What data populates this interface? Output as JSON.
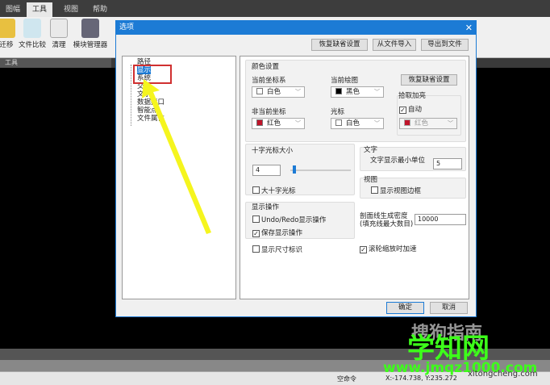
{
  "menubar": {
    "items": [
      "图幅",
      "工具",
      "视图",
      "帮助"
    ],
    "active": "工具"
  },
  "ribbon": {
    "buttons": [
      "迁移",
      "文件比较",
      "清理",
      "模块管理器"
    ],
    "group_label": "工具"
  },
  "dialog": {
    "title": "选项",
    "top_buttons": [
      "恢复缺省设置",
      "从文件导入",
      "导出到文件"
    ],
    "tree": [
      "路径",
      "显示",
      "系统",
      "交互",
      "文字",
      "数据接口",
      "智能点",
      "文件属性"
    ],
    "selected": "显示",
    "color_settings": {
      "title": "颜色设置",
      "current_coord_label": "当前坐标系",
      "current_coord_value": "白色",
      "current_draw_label": "当前绘图",
      "current_draw_value": "黑色",
      "noncurrent_coord_label": "非当前坐标",
      "noncurrent_coord_value": "红色",
      "cursor_label": "光标",
      "cursor_value": "白色",
      "restore_button": "恢复缺省设置",
      "pick_title": "拾取加亮",
      "auto_label": "自动",
      "auto_checked": true,
      "pick_value": "红色"
    },
    "crosshair": {
      "title": "十字光标大小",
      "value": "4",
      "slider_fraction": 0.04,
      "big_crosshair_label": "大十字光标",
      "big_crosshair_checked": false
    },
    "text": {
      "title": "文字",
      "min_unit_label": "文字显示最小单位",
      "min_unit_value": "5"
    },
    "view": {
      "title": "视图",
      "border_label": "显示视图边框",
      "border_checked": false
    },
    "display_ops": {
      "title": "显示操作",
      "undo_label": "Undo/Redo显示操作",
      "undo_checked": false,
      "save_label": "保存显示操作",
      "save_checked": true
    },
    "hatch": {
      "label1": "剖面线生成密度",
      "label2": "(填充线最大数目)",
      "value": "10000"
    },
    "dim_label": "显示尺寸标识",
    "dim_checked": false,
    "wheel_label": "滚轮缩放时加速",
    "wheel_checked": true,
    "ok": "确定",
    "cancel": "取消"
  },
  "status": {
    "command": "空命令",
    "coords": "X:-174.738, Y:235.272"
  },
  "watermarks": {
    "a": "搜狗指南",
    "b": "学知网",
    "c": "www.jmqz1000.com",
    "d": "xitongcheng.com"
  },
  "colors": {
    "accent": "#1c7bd5",
    "red": "#c0142a",
    "arrow": "#f5f51e"
  }
}
